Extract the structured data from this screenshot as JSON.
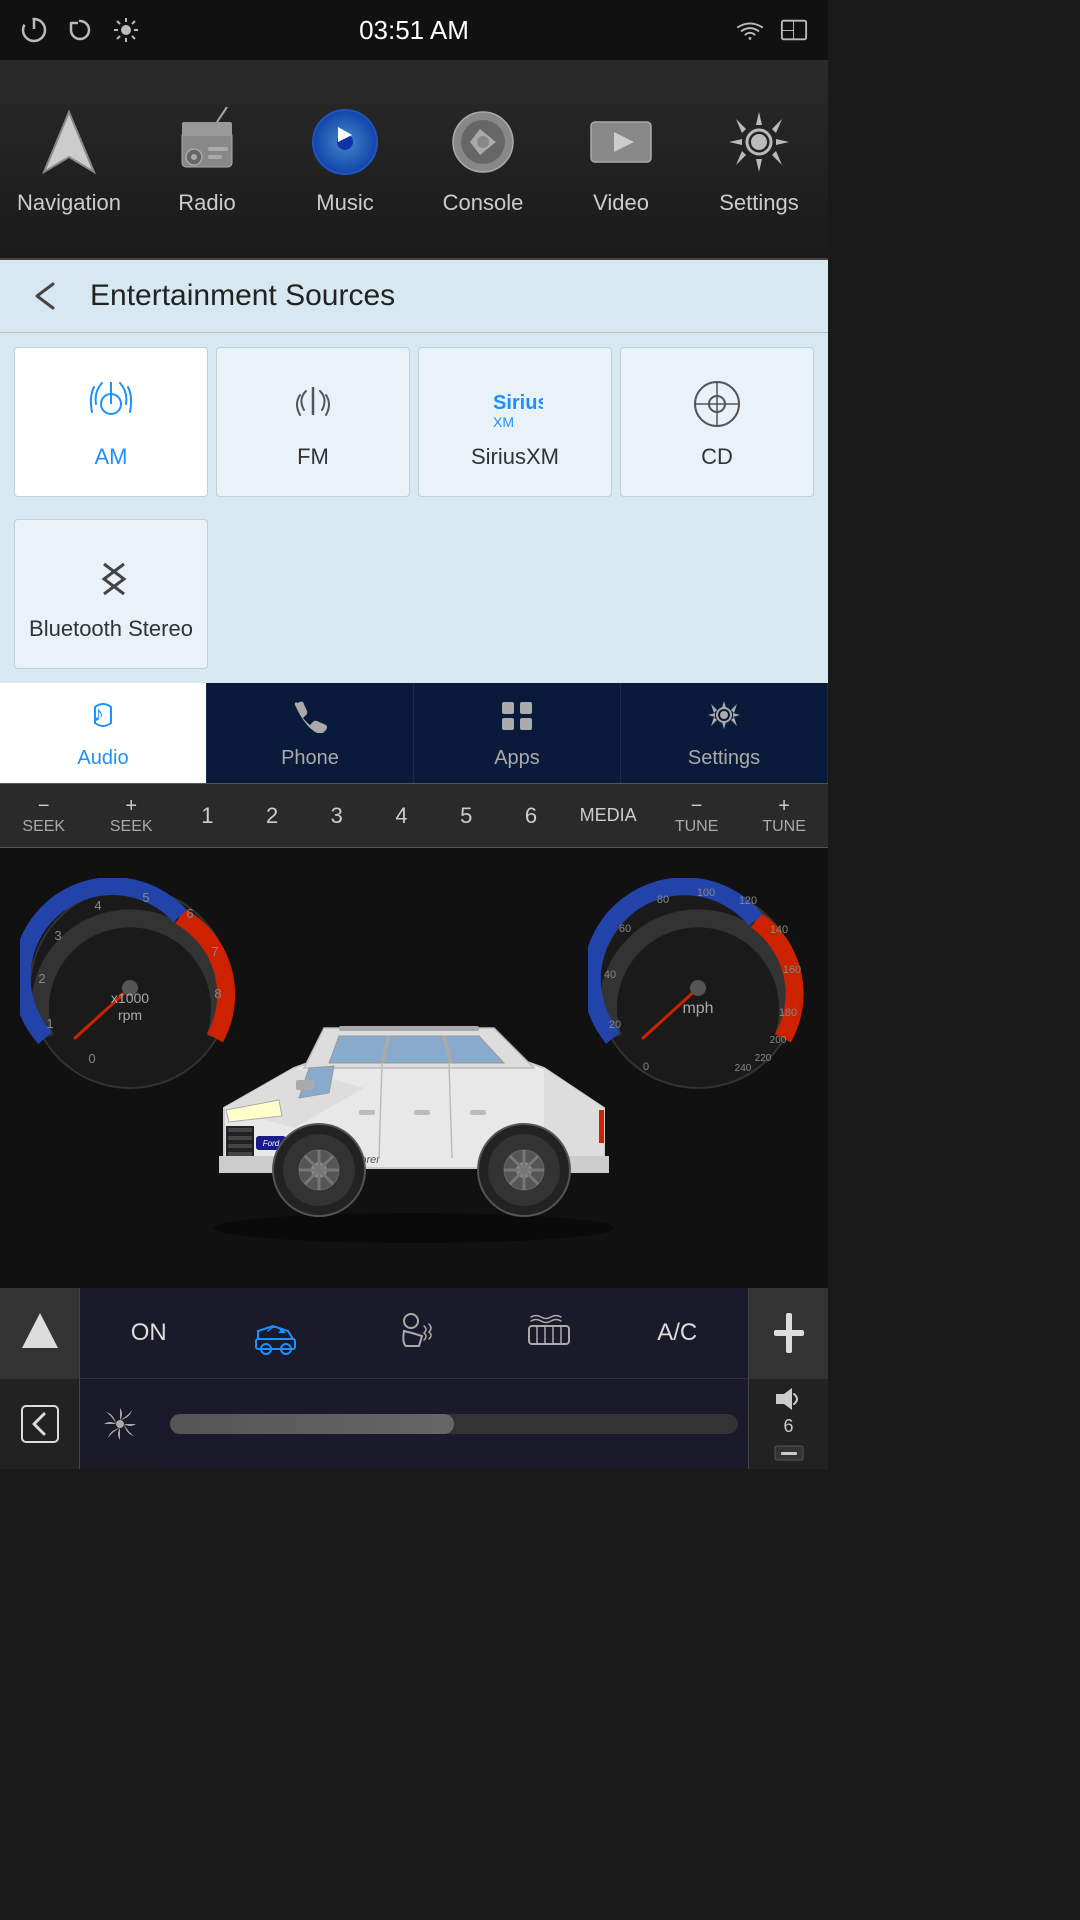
{
  "statusBar": {
    "time": "03:51 AM",
    "leftIcons": [
      "power-icon",
      "refresh-icon",
      "brightness-icon"
    ],
    "rightIcons": [
      "wifi-icon",
      "window-icon"
    ]
  },
  "topNav": {
    "items": [
      {
        "id": "navigation",
        "label": "Navigation"
      },
      {
        "id": "radio",
        "label": "Radio"
      },
      {
        "id": "music",
        "label": "Music"
      },
      {
        "id": "console",
        "label": "Console"
      },
      {
        "id": "video",
        "label": "Video"
      },
      {
        "id": "settings",
        "label": "Settings"
      }
    ]
  },
  "entertainmentSources": {
    "title": "Entertainment Sources",
    "backLabel": "←",
    "sources": [
      {
        "id": "am",
        "label": "AM",
        "active": true
      },
      {
        "id": "fm",
        "label": "FM",
        "active": false
      },
      {
        "id": "siriusxm",
        "label": "SiriusXM",
        "active": false
      },
      {
        "id": "cd",
        "label": "CD",
        "active": false
      },
      {
        "id": "bluetooth",
        "label": "Bluetooth Stereo",
        "active": false
      }
    ]
  },
  "bottomTabs": {
    "items": [
      {
        "id": "audio",
        "label": "Audio",
        "active": true
      },
      {
        "id": "phone",
        "label": "Phone",
        "active": false
      },
      {
        "id": "apps",
        "label": "Apps",
        "active": false
      },
      {
        "id": "settings",
        "label": "Settings",
        "active": false
      }
    ]
  },
  "seekBar": {
    "seekMinus": "−",
    "seekPlus": "+",
    "seekLabel": "SEEK",
    "presets": [
      "1",
      "2",
      "3",
      "4",
      "5",
      "6"
    ],
    "mediaLabel": "MEDIA",
    "tuneMinus": "−",
    "tunePlus": "+",
    "tuneLabel": "TUNE"
  },
  "dashboard": {
    "rpmLabel": "x1000\nrpm",
    "speedLabel": "mph",
    "carModel": "Explorer"
  },
  "climate": {
    "upArrow": "▲",
    "onLabel": "ON",
    "acLabel": "A/C",
    "plusLabel": "+",
    "minusLabel": "−",
    "backLabel": "↩"
  },
  "volume": {
    "icon": "🔊",
    "level": "6"
  }
}
